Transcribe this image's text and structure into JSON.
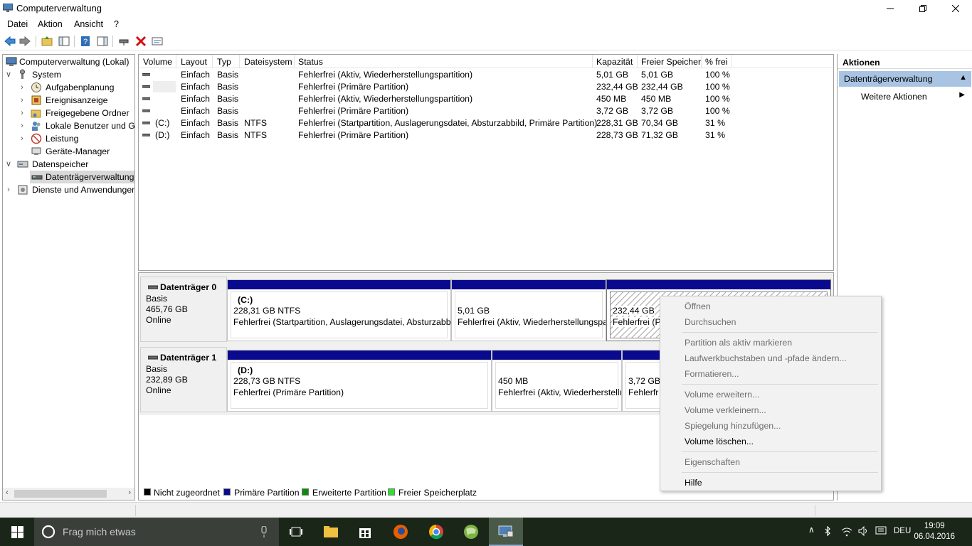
{
  "window": {
    "title": "Computerverwaltung"
  },
  "menu": [
    "Datei",
    "Aktion",
    "Ansicht",
    "?"
  ],
  "tree": {
    "items": [
      {
        "label": "Computerverwaltung (Lokal)",
        "icon": "computer-management-icon"
      },
      {
        "label": "System",
        "icon": "system-tools-icon"
      },
      {
        "label": "Aufgabenplanung",
        "icon": "clock-icon"
      },
      {
        "label": "Ereignisanzeige",
        "icon": "event-viewer-icon"
      },
      {
        "label": "Freigegebene Ordner",
        "icon": "shared-folder-icon"
      },
      {
        "label": "Lokale Benutzer und Gruppen",
        "icon": "users-icon"
      },
      {
        "label": "Leistung",
        "icon": "performance-icon"
      },
      {
        "label": "Geräte-Manager",
        "icon": "device-manager-icon"
      },
      {
        "label": "Datenspeicher",
        "icon": "storage-icon"
      },
      {
        "label": "Datenträgerverwaltung",
        "icon": "disk-management-icon"
      },
      {
        "label": "Dienste und Anwendungen",
        "icon": "services-icon"
      }
    ]
  },
  "volumes": {
    "headers": [
      "Volume",
      "Layout",
      "Typ",
      "Dateisystem",
      "Status",
      "Kapazität",
      "Freier Speicher",
      "% frei"
    ],
    "rows": [
      {
        "volume": "",
        "layout": "Einfach",
        "type": "Basis",
        "fs": "",
        "status": "Fehlerfrei (Aktiv, Wiederherstellungspartition)",
        "capacity": "5,01 GB",
        "free": "5,01 GB",
        "pct": "100 %"
      },
      {
        "volume": "",
        "layout": "Einfach",
        "type": "Basis",
        "fs": "",
        "status": "Fehlerfrei (Primäre Partition)",
        "capacity": "232,44 GB",
        "free": "232,44 GB",
        "pct": "100 %"
      },
      {
        "volume": "",
        "layout": "Einfach",
        "type": "Basis",
        "fs": "",
        "status": "Fehlerfrei (Aktiv, Wiederherstellungspartition)",
        "capacity": "450 MB",
        "free": "450 MB",
        "pct": "100 %"
      },
      {
        "volume": "",
        "layout": "Einfach",
        "type": "Basis",
        "fs": "",
        "status": "Fehlerfrei (Primäre Partition)",
        "capacity": "3,72 GB",
        "free": "3,72 GB",
        "pct": "100 %"
      },
      {
        "volume": "(C:)",
        "layout": "Einfach",
        "type": "Basis",
        "fs": "NTFS",
        "status": "Fehlerfrei (Startpartition, Auslagerungsdatei, Absturzabbild, Primäre Partition)",
        "capacity": "228,31 GB",
        "free": "70,34 GB",
        "pct": "31 %"
      },
      {
        "volume": "(D:)",
        "layout": "Einfach",
        "type": "Basis",
        "fs": "NTFS",
        "status": "Fehlerfrei (Primäre Partition)",
        "capacity": "228,73 GB",
        "free": "71,32 GB",
        "pct": "31 %"
      }
    ]
  },
  "disks": [
    {
      "name": "Datenträger 0",
      "type": "Basis",
      "size": "465,76 GB",
      "state": "Online",
      "partitions": [
        {
          "label": "(C:)",
          "size": "228,31 GB NTFS",
          "status": "Fehlerfrei (Startpartition, Auslagerungsdatei, Absturzabbi"
        },
        {
          "label": "",
          "size": "5,01 GB",
          "status": "Fehlerfrei (Aktiv, Wiederherstellungspa"
        },
        {
          "label": "",
          "size": "232,44 GB",
          "status": "Fehlerfrei (Pr"
        }
      ]
    },
    {
      "name": "Datenträger 1",
      "type": "Basis",
      "size": "232,89 GB",
      "state": "Online",
      "partitions": [
        {
          "label": "(D:)",
          "size": "228,73 GB NTFS",
          "status": "Fehlerfrei (Primäre Partition)"
        },
        {
          "label": "",
          "size": "450 MB",
          "status": "Fehlerfrei (Aktiv, Wiederherstellu"
        },
        {
          "label": "",
          "size": "3,72 GB",
          "status": "Fehlerfr"
        }
      ]
    }
  ],
  "legend": [
    {
      "label": "Nicht zugeordnet",
      "color": "#000000"
    },
    {
      "label": "Primäre Partition",
      "color": "#0a0a8e"
    },
    {
      "label": "Erweiterte Partition",
      "color": "#0c8a0c"
    },
    {
      "label": "Freier Speicherplatz",
      "color": "#2fe02f"
    }
  ],
  "actions": {
    "header": "Aktionen",
    "selected": "Datenträgerverwaltung",
    "more": "Weitere Aktionen"
  },
  "context_menu": {
    "items": [
      {
        "label": "Öffnen",
        "enabled": false
      },
      {
        "label": "Durchsuchen",
        "enabled": false
      },
      {
        "label": "Partition als aktiv markieren",
        "enabled": false
      },
      {
        "label": "Laufwerkbuchstaben und -pfade ändern...",
        "enabled": false
      },
      {
        "label": "Formatieren...",
        "enabled": false
      },
      {
        "label": "Volume erweitern...",
        "enabled": false
      },
      {
        "label": "Volume verkleinern...",
        "enabled": false
      },
      {
        "label": "Spiegelung hinzufügen...",
        "enabled": false
      },
      {
        "label": "Volume löschen...",
        "enabled": true
      },
      {
        "label": "Eigenschaften",
        "enabled": false
      },
      {
        "label": "Hilfe",
        "enabled": true
      }
    ]
  },
  "taskbar": {
    "search_placeholder": "Frag mich etwas",
    "language": "DEU",
    "time": "19:09",
    "date": "06.04.2016"
  }
}
